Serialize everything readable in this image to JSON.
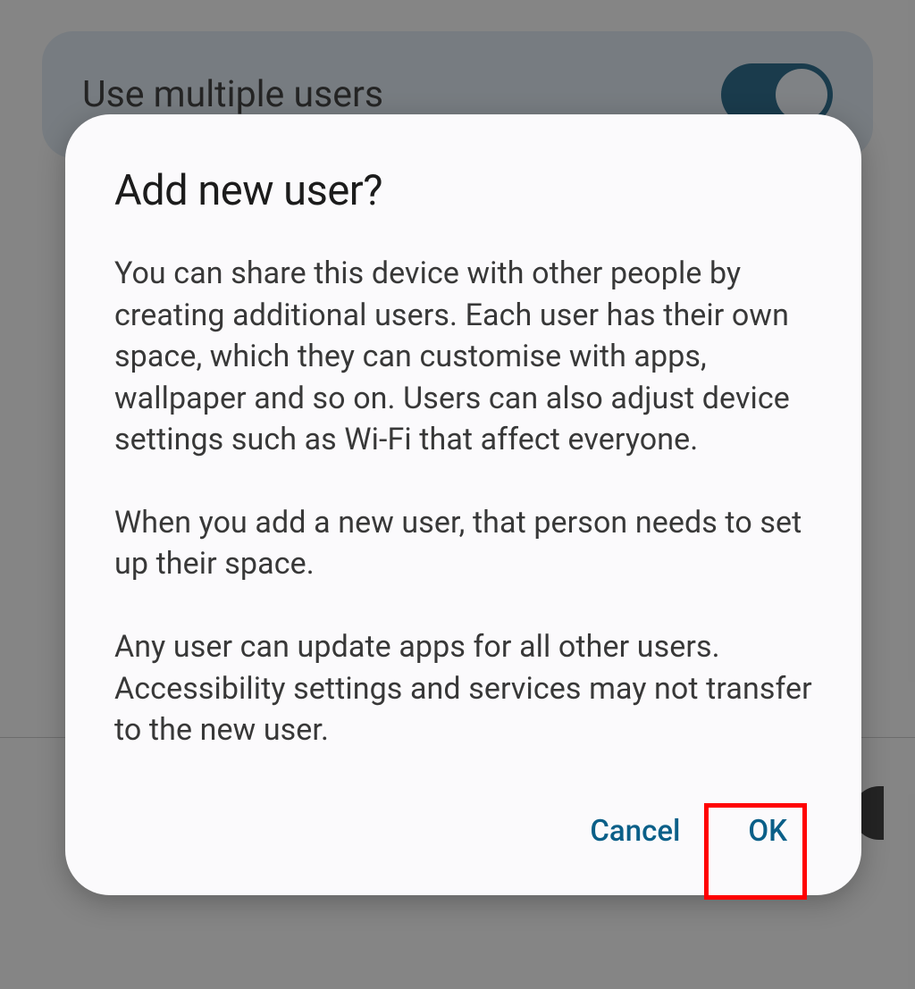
{
  "background": {
    "card_title": "Use multiple users"
  },
  "dialog": {
    "title": "Add new user?",
    "para1": "You can share this device with other people by creating additional users. Each user has their own space, which they can customise with apps, wallpaper and so on. Users can also adjust device settings such as Wi-Fi that affect everyone.",
    "para2": "When you add a new user, that person needs to set up their space.",
    "para3": "Any user can update apps for all other users. Accessibility settings and services may not transfer to the new user.",
    "cancel_label": "Cancel",
    "ok_label": "OK"
  }
}
